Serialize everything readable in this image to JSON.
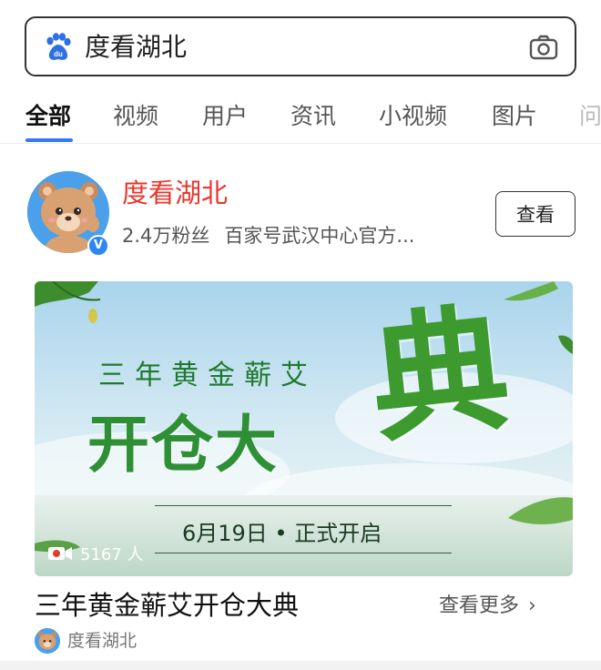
{
  "search": {
    "query": "度看湖北",
    "logo_icon": "baidu-paw-icon",
    "camera_icon": "camera-icon"
  },
  "tabs": [
    {
      "label": "全部",
      "active": true
    },
    {
      "label": "视频",
      "active": false
    },
    {
      "label": "用户",
      "active": false
    },
    {
      "label": "资讯",
      "active": false
    },
    {
      "label": "小视频",
      "active": false
    },
    {
      "label": "图片",
      "active": false
    },
    {
      "label": "问",
      "active": false
    }
  ],
  "account": {
    "name": "度看湖北",
    "followers": "2.4万粉丝",
    "description": "百家号武汉中心官方...",
    "verified_badge": "V",
    "view_button": "查看"
  },
  "banner": {
    "subtitle": "三年黄金蕲艾",
    "headline": "开仓大",
    "headline_big": "典",
    "date_text": "6月19日 • 正式开启",
    "viewers": "5167 人"
  },
  "result": {
    "title": "三年黄金蕲艾开仓大典",
    "more_label": "查看更多",
    "chevron": "›",
    "source_name": "度看湖北"
  },
  "colors": {
    "accent": "#3478f6",
    "account_name": "#e8372c",
    "banner_green": "#2f8f35"
  }
}
